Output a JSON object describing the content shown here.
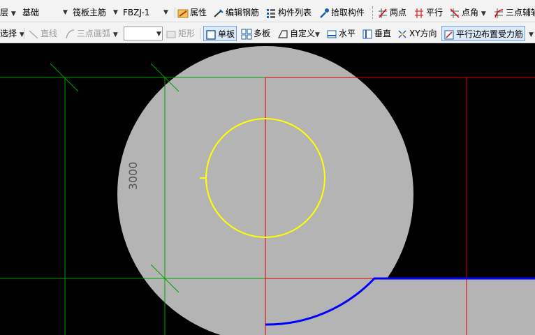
{
  "toolbar1": {
    "floor_fragment": "层",
    "category": "基础",
    "rebar_type": "筏板主筋",
    "component": "FBZJ-1",
    "properties": "属性",
    "edit_rebar": "编辑钢筋",
    "component_list": "构件列表",
    "pick_component": "拾取构件",
    "two_points": "两点",
    "parallel": "平行",
    "point_angle": "点角",
    "three_point_aux": "三点辅轴"
  },
  "toolbar2": {
    "select_fragment": "选择",
    "line": "直线",
    "three_point_arc": "三点画弧",
    "rectangle": "矩形",
    "single_slab": "单板",
    "multi_slab": "多板",
    "custom": "自定义",
    "horizontal": "水平",
    "vertical": "垂直",
    "xy_direction": "XY方向",
    "parallel_edge": "平行边布置受力筋"
  },
  "canvas": {
    "dimension_label": "3000"
  },
  "colors": {
    "background": "#000000",
    "slab_fill": "#b4b4b4",
    "axis_green": "#00a000",
    "axis_red": "#e00000",
    "circle_yellow": "#ffff00",
    "edge_blue": "#0000ff"
  }
}
